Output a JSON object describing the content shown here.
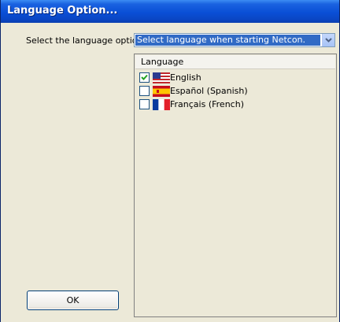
{
  "window": {
    "title": "Language Option..."
  },
  "form": {
    "select_label": "Select the language option",
    "combo_value": "Select language when starting Netcon."
  },
  "list": {
    "header": "Language",
    "items": [
      {
        "label": "English",
        "checked": true,
        "flag": "us-flag-icon"
      },
      {
        "label": "Español (Spanish)",
        "checked": false,
        "flag": "spain-flag-icon"
      },
      {
        "label": "Français (French)",
        "checked": false,
        "flag": "france-flag-icon"
      }
    ]
  },
  "buttons": {
    "ok": "OK"
  },
  "colors": {
    "titlebar": "#0a4fd6",
    "selection": "#316ac5",
    "window_bg": "#ece9d8"
  }
}
